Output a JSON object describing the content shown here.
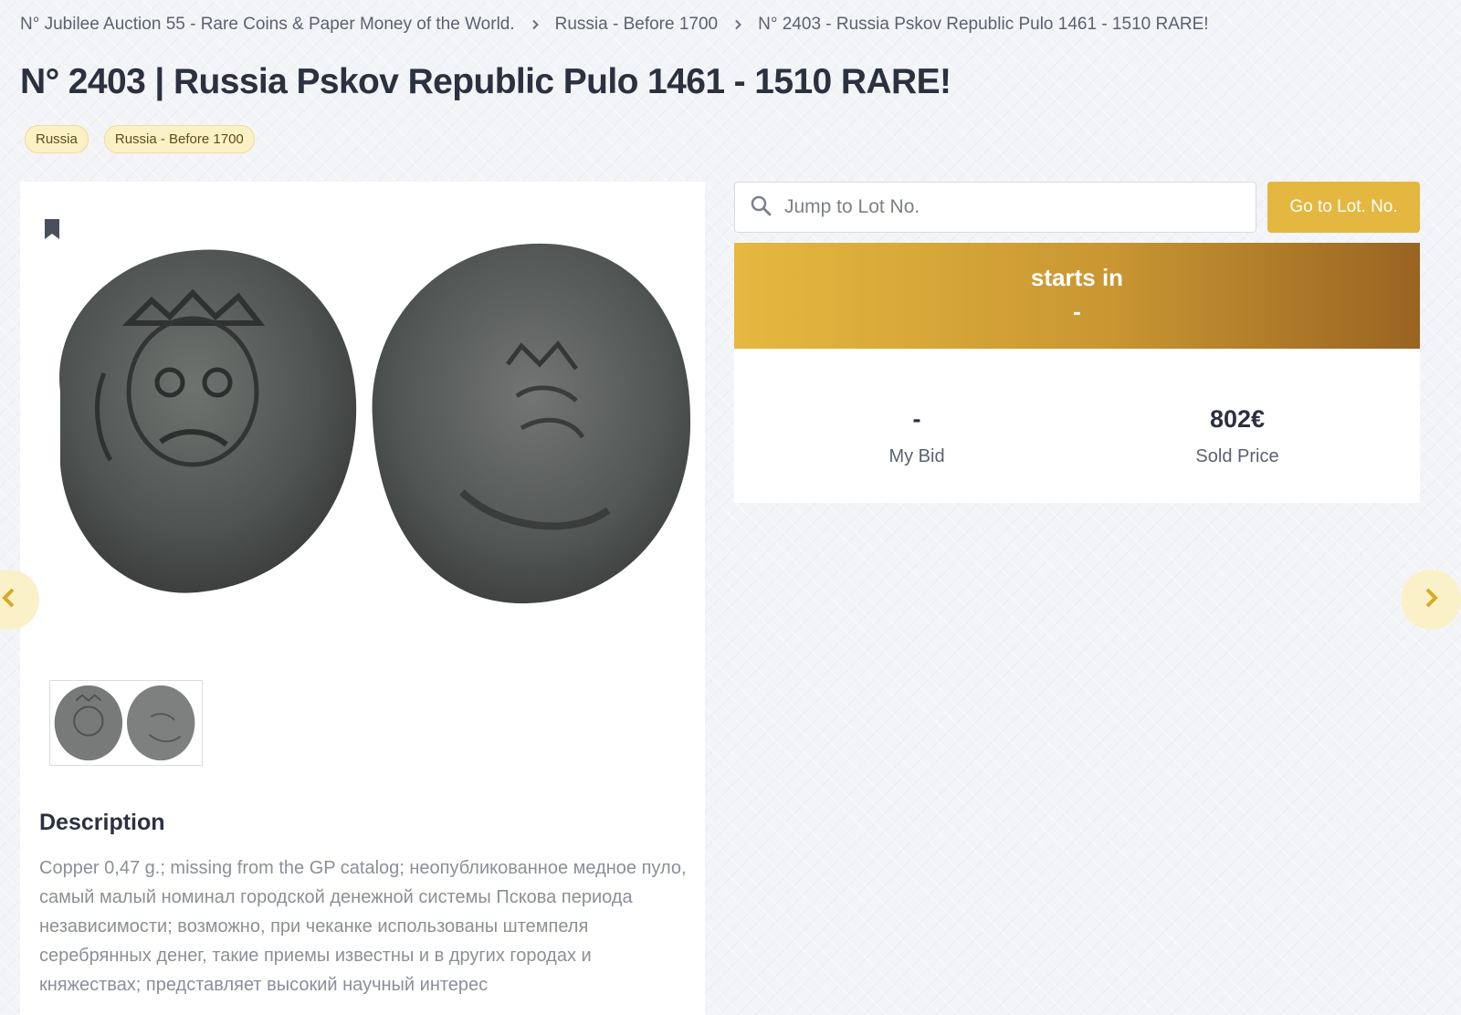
{
  "breadcrumb": {
    "items": [
      "N° Jubilee Auction 55 - Rare Coins & Paper Money of the World.",
      "Russia - Before 1700",
      "N° 2403 - Russia Pskov Republic Pulo 1461 - 1510 RARE!"
    ]
  },
  "title": "N° 2403 | Russia Pskov Republic Pulo 1461 - 1510 RARE!",
  "tags": [
    "Russia",
    "Russia - Before 1700"
  ],
  "search": {
    "placeholder": "Jump to Lot No.",
    "value": ""
  },
  "go_button_label": "Go to Lot. No.",
  "countdown": {
    "label": "starts in",
    "value": "-"
  },
  "bid": {
    "my_bid_value": "-",
    "my_bid_label": "My Bid",
    "sold_price_value": "802€",
    "sold_price_label": "Sold Price"
  },
  "description": {
    "heading": "Description",
    "text": "Copper 0,47 g.; missing from the GP catalog; неопубликованное медное пуло, самый малый номинал городской денежной системы Пскова периода независимости; возможно, при чеканке использованы штемпеля серебрянных денег, такие приемы известны и в других городах и княжествах; представляет высокий научный интерес"
  },
  "icons": {
    "bookmark": "bookmark-icon",
    "search": "search-icon",
    "prev": "chevron-left-icon",
    "next": "chevron-right-icon"
  },
  "colors": {
    "accent": "#e4b740",
    "tag_bg": "#fbf1c6",
    "banner_start": "#e6b83f",
    "banner_end": "#996422",
    "text_dark": "#2c3140"
  }
}
